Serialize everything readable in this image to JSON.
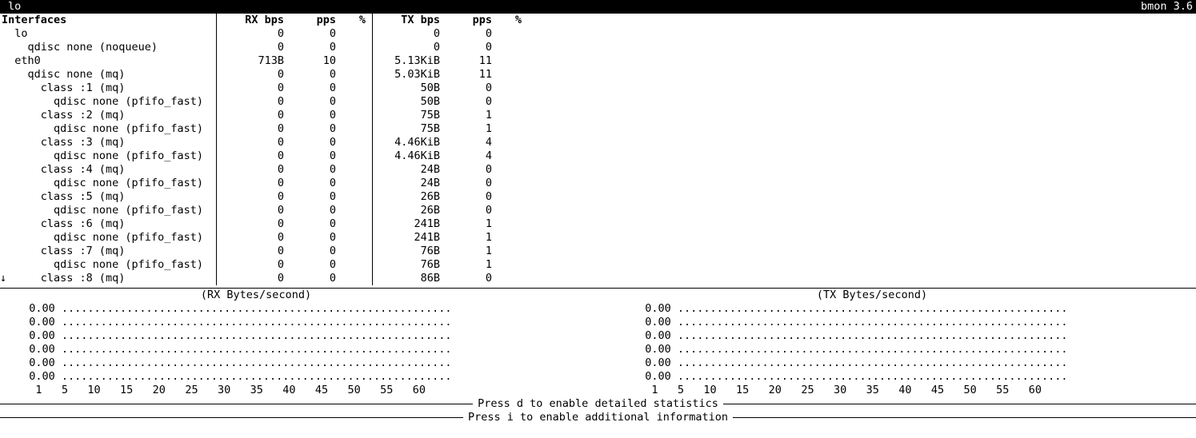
{
  "titlebar": {
    "left": " lo",
    "right": "bmon 3.6"
  },
  "headers": {
    "iface": "Interfaces",
    "rx_bps": "RX bps",
    "rx_pps": "pps",
    "rx_pct": "%",
    "tx_bps": "TX bps",
    "tx_pps": "pps",
    "tx_pct": "%"
  },
  "rows": [
    {
      "indent": 0,
      "cursor": true,
      "name": "lo",
      "rx_bps": "0",
      "rx_pps": "0",
      "rx_pct": "",
      "tx_bps": "0",
      "tx_pps": "0",
      "tx_pct": ""
    },
    {
      "indent": 1,
      "cursor": false,
      "name": "qdisc none (noqueue)",
      "rx_bps": "0",
      "rx_pps": "0",
      "rx_pct": "",
      "tx_bps": "0",
      "tx_pps": "0",
      "tx_pct": ""
    },
    {
      "indent": 0,
      "cursor": false,
      "name": "eth0",
      "rx_bps": "713B",
      "rx_pps": "10",
      "rx_pct": "",
      "tx_bps": "5.13KiB",
      "tx_pps": "11",
      "tx_pct": ""
    },
    {
      "indent": 1,
      "cursor": false,
      "name": "qdisc none (mq)",
      "rx_bps": "0",
      "rx_pps": "0",
      "rx_pct": "",
      "tx_bps": "5.03KiB",
      "tx_pps": "11",
      "tx_pct": ""
    },
    {
      "indent": 2,
      "cursor": false,
      "name": "class :1 (mq)",
      "rx_bps": "0",
      "rx_pps": "0",
      "rx_pct": "",
      "tx_bps": "50B",
      "tx_pps": "0",
      "tx_pct": ""
    },
    {
      "indent": 3,
      "cursor": false,
      "name": "qdisc none (pfifo_fast)",
      "rx_bps": "0",
      "rx_pps": "0",
      "rx_pct": "",
      "tx_bps": "50B",
      "tx_pps": "0",
      "tx_pct": ""
    },
    {
      "indent": 2,
      "cursor": false,
      "name": "class :2 (mq)",
      "rx_bps": "0",
      "rx_pps": "0",
      "rx_pct": "",
      "tx_bps": "75B",
      "tx_pps": "1",
      "tx_pct": ""
    },
    {
      "indent": 3,
      "cursor": false,
      "name": "qdisc none (pfifo_fast)",
      "rx_bps": "0",
      "rx_pps": "0",
      "rx_pct": "",
      "tx_bps": "75B",
      "tx_pps": "1",
      "tx_pct": ""
    },
    {
      "indent": 2,
      "cursor": false,
      "name": "class :3 (mq)",
      "rx_bps": "0",
      "rx_pps": "0",
      "rx_pct": "",
      "tx_bps": "4.46KiB",
      "tx_pps": "4",
      "tx_pct": ""
    },
    {
      "indent": 3,
      "cursor": false,
      "name": "qdisc none (pfifo_fast)",
      "rx_bps": "0",
      "rx_pps": "0",
      "rx_pct": "",
      "tx_bps": "4.46KiB",
      "tx_pps": "4",
      "tx_pct": ""
    },
    {
      "indent": 2,
      "cursor": false,
      "name": "class :4 (mq)",
      "rx_bps": "0",
      "rx_pps": "0",
      "rx_pct": "",
      "tx_bps": "24B",
      "tx_pps": "0",
      "tx_pct": ""
    },
    {
      "indent": 3,
      "cursor": false,
      "name": "qdisc none (pfifo_fast)",
      "rx_bps": "0",
      "rx_pps": "0",
      "rx_pct": "",
      "tx_bps": "24B",
      "tx_pps": "0",
      "tx_pct": ""
    },
    {
      "indent": 2,
      "cursor": false,
      "name": "class :5 (mq)",
      "rx_bps": "0",
      "rx_pps": "0",
      "rx_pct": "",
      "tx_bps": "26B",
      "tx_pps": "0",
      "tx_pct": ""
    },
    {
      "indent": 3,
      "cursor": false,
      "name": "qdisc none (pfifo_fast)",
      "rx_bps": "0",
      "rx_pps": "0",
      "rx_pct": "",
      "tx_bps": "26B",
      "tx_pps": "0",
      "tx_pct": ""
    },
    {
      "indent": 2,
      "cursor": false,
      "name": "class :6 (mq)",
      "rx_bps": "0",
      "rx_pps": "0",
      "rx_pct": "",
      "tx_bps": "241B",
      "tx_pps": "1",
      "tx_pct": ""
    },
    {
      "indent": 3,
      "cursor": false,
      "name": "qdisc none (pfifo_fast)",
      "rx_bps": "0",
      "rx_pps": "0",
      "rx_pct": "",
      "tx_bps": "241B",
      "tx_pps": "1",
      "tx_pct": ""
    },
    {
      "indent": 2,
      "cursor": false,
      "name": "class :7 (mq)",
      "rx_bps": "0",
      "rx_pps": "0",
      "rx_pct": "",
      "tx_bps": "76B",
      "tx_pps": "1",
      "tx_pct": ""
    },
    {
      "indent": 3,
      "cursor": false,
      "name": "qdisc none (pfifo_fast)",
      "rx_bps": "0",
      "rx_pps": "0",
      "rx_pct": "",
      "tx_bps": "76B",
      "tx_pps": "1",
      "tx_pct": ""
    },
    {
      "indent": 2,
      "cursor": false,
      "name": "class :8 (mq)",
      "rx_bps": "0",
      "rx_pps": "0",
      "rx_pct": "",
      "tx_bps": "86B",
      "tx_pps": "0",
      "tx_pct": ""
    }
  ],
  "scroll_indicator": "↓",
  "graphs": {
    "rx": {
      "title": "(RX Bytes/second)",
      "y_values": [
        "0.00",
        "0.00",
        "0.00",
        "0.00",
        "0.00",
        "0.00"
      ],
      "x_ticks": "   1   5   10   15   20   25   30   35   40   45   50   55   60"
    },
    "tx": {
      "title": "(TX Bytes/second)",
      "y_values": [
        "0.00",
        "0.00",
        "0.00",
        "0.00",
        "0.00",
        "0.00"
      ],
      "x_ticks": "   1   5   10   15   20   25   30   35   40   45   50   55   60"
    },
    "dots": "............................................................"
  },
  "hints": {
    "d": "Press d to enable detailed statistics",
    "i": "Press i to enable additional information"
  }
}
